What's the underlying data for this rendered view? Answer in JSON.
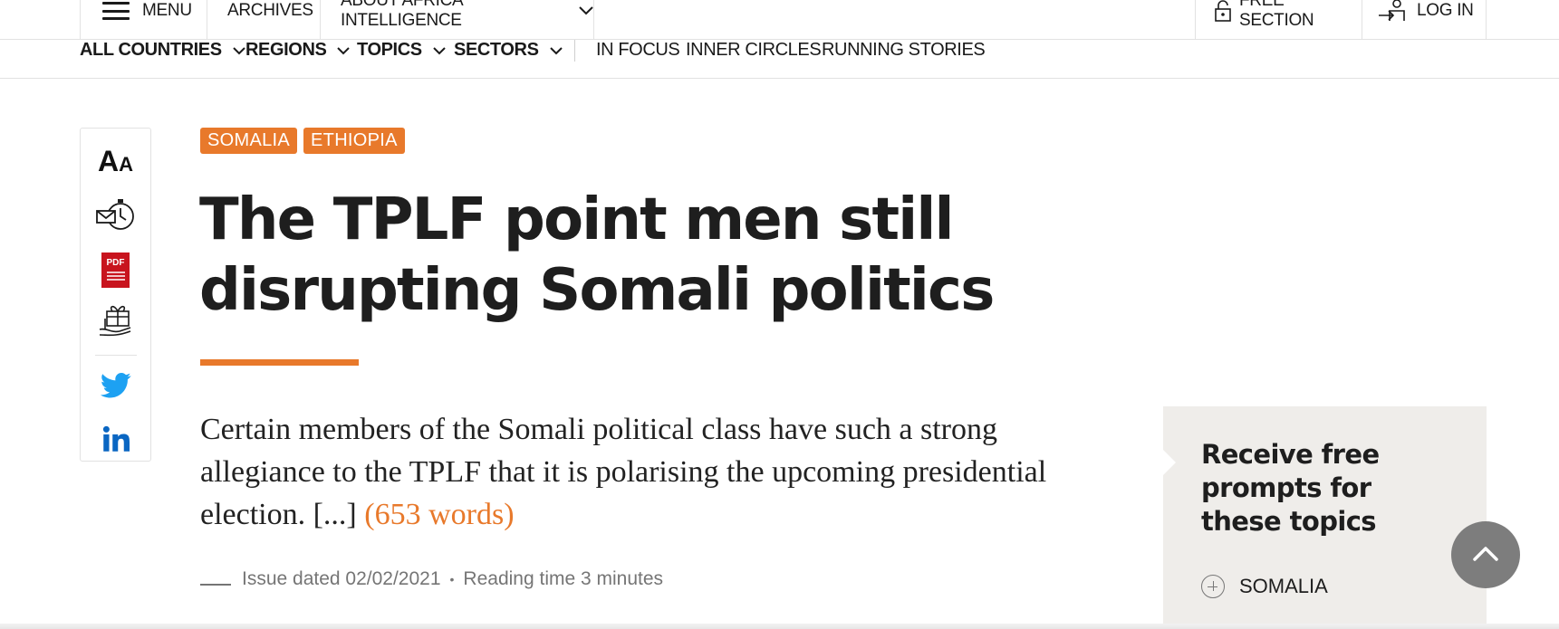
{
  "topbar": {
    "menu_label": "MENU",
    "archives_label": "ARCHIVES",
    "about_label": "ABOUT AFRICA INTELLIGENCE",
    "free_section_label": "FREE SECTION",
    "login_label": "LOG IN"
  },
  "subnav": {
    "items": [
      {
        "label": "ALL COUNTRIES"
      },
      {
        "label": "REGIONS"
      },
      {
        "label": "TOPICS"
      },
      {
        "label": "SECTORS"
      },
      {
        "label": "IN FOCUS"
      },
      {
        "label": "INNER CIRCLES"
      },
      {
        "label": "RUNNING STORIES"
      }
    ]
  },
  "toolbar": {
    "font_size_big": "A",
    "font_size_small": "A",
    "pdf_label": "PDF"
  },
  "article": {
    "tags": [
      {
        "label": "SOMALIA"
      },
      {
        "label": "ETHIOPIA"
      }
    ],
    "title": "The TPLF point men still disrupting Somali politics",
    "lede_text": "Certain members of the Somali political class have such a strong allegiance to the TPLF that it is polarising the upcoming presidential election. [...] ",
    "word_count": "(653 words)",
    "issue_date": "Issue dated 02/02/2021",
    "reading_time": "Reading time 3 minutes",
    "meta_separator": "•"
  },
  "prompt_box": {
    "title": "Receive free prompts for these topics",
    "topics": [
      {
        "label": "SOMALIA"
      }
    ]
  },
  "colors": {
    "accent": "#e8792b",
    "twitter": "#1da1f2",
    "linkedin": "#0a66c2",
    "pdf": "#c8141e",
    "panel_bg": "#efedea"
  },
  "icons": [
    "menu-icon",
    "chevron-down-icon",
    "padlock-icon",
    "login-icon",
    "font-size-icon",
    "email-alert-icon",
    "pdf-icon",
    "gift-icon",
    "twitter-icon",
    "linkedin-icon",
    "plus-circle-icon",
    "chevron-up-icon"
  ]
}
